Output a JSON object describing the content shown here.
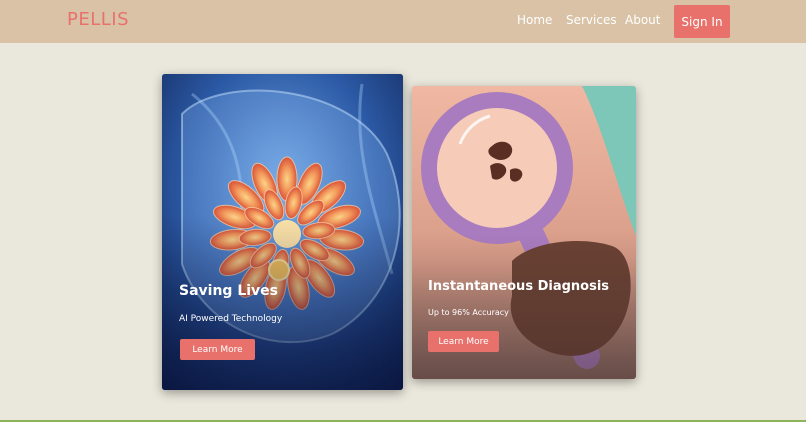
{
  "brand": {
    "logo": "PELLIS"
  },
  "nav": {
    "links": [
      "Home",
      "Services",
      "About"
    ],
    "signin_label": "Sign In"
  },
  "cards": [
    {
      "title": "Saving Lives",
      "subtitle": "AI Powered Technology",
      "button_label": "Learn More",
      "image": "breast-scan-illustration"
    },
    {
      "title": "Instantaneous Diagnosis",
      "subtitle": "Up to 96% Accuracy",
      "button_label": "Learn More",
      "image": "magnifying-glass-illustration"
    }
  ],
  "colors": {
    "accent": "#e8716c",
    "navbar": "#d9c2a5",
    "background": "#eae7dc"
  }
}
